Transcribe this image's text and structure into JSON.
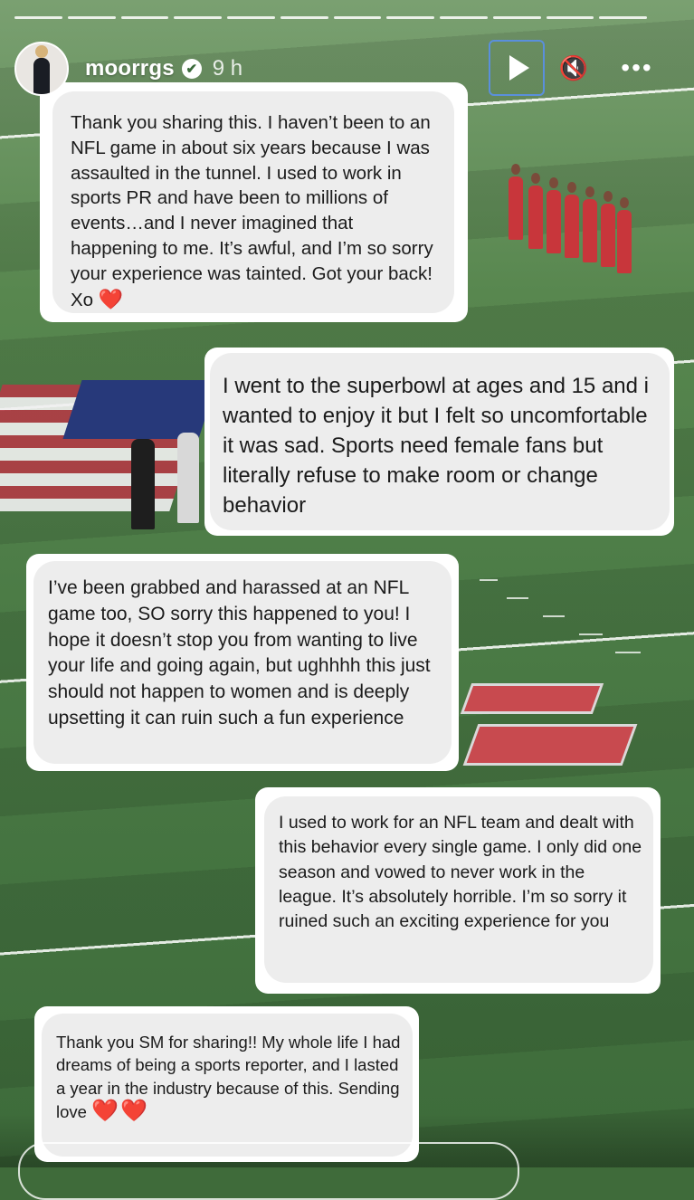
{
  "story": {
    "username": "moorrgs",
    "time": "9 h",
    "progress_segments": 12,
    "icons": {
      "verified": "verified-badge-icon",
      "play": "play-icon",
      "mute": "speaker-muted-icon",
      "more": "more-options-icon"
    },
    "glyphs": {
      "verified": "✔",
      "mute": "🔇",
      "more": "•••"
    }
  },
  "messages": [
    {
      "text": "Thank you sharing this. I haven’t been to an NFL game in about six years because I was assaulted in the tunnel. I used to work in sports PR and have been to millions of events…and I never imagined that happening to me. It’s awful, and I’m so sorry your experience was tainted. Got your back! Xo",
      "emoji": "❤️"
    },
    {
      "text": "I went to the superbowl at ages and 15 and i wanted to enjoy it but I felt so uncomfortable it was sad. Sports need female fans but literally refuse to make room or change behavior",
      "emoji": ""
    },
    {
      "text": "I’ve been grabbed and harassed at an NFL game too, SO sorry this happened to you! I hope it doesn’t stop you from wanting to live your life and going again, but ughhhh this just should not happen to women and is deeply upsetting it can ruin such a fun experience",
      "emoji": ""
    },
    {
      "text": "I used to work for an NFL team and dealt with this behavior every single game. I only did one season and vowed to never work in the league. It’s absolutely horrible. I’m so sorry it ruined such an exciting experience for you",
      "emoji": ""
    },
    {
      "text": "Thank you SM for sharing!! My whole life I had dreams of being a sports reporter, and I lasted a year in the industry because of this. Sending love",
      "emoji": "❤️❤️"
    }
  ]
}
